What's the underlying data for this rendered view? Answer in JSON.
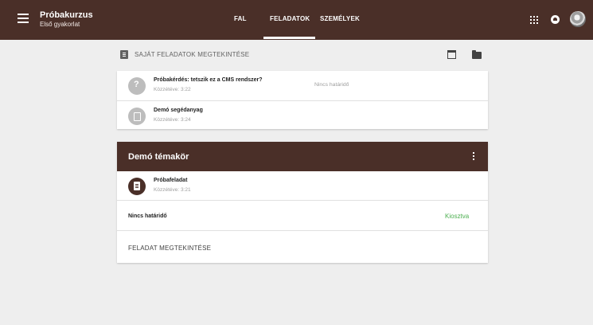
{
  "course": {
    "title": "Próbakurzus",
    "subtitle": "Első gyakorlat"
  },
  "nav": {
    "tabs": [
      {
        "label": "FAL"
      },
      {
        "label": "FELADATOK",
        "active": true
      },
      {
        "label": "SZEMÉLYEK"
      }
    ],
    "icons": [
      "menu-icon",
      "apps-icon",
      "notification-icon",
      "avatar"
    ]
  },
  "own_tasks": {
    "label": "SAJÁT FELADATOK MEGTEKINTÉSE",
    "icons": [
      "assignment-icon",
      "calendar-icon",
      "folder-icon"
    ]
  },
  "items": [
    {
      "title": "Próbakérdés: tetszik ez a CMS rendszer?",
      "published": "Közzétéve: 3:22",
      "due": "Nincs határidő",
      "icon": "question-icon"
    },
    {
      "title": "Demó segédanyag",
      "published": "Közzétéve: 3:24",
      "icon": "material-icon"
    }
  ],
  "topic": {
    "title": "Demó témakör",
    "task": {
      "title": "Próbafeladat",
      "published": "Közzétéve: 3:21"
    },
    "deadline": "Nincs határidő",
    "status": "Kiosztva",
    "view_link": "FELADAT MEGTEKINTÉSE"
  },
  "colors": {
    "brand": "#4a2f28",
    "status_green": "#4caf50",
    "background": "#eeeeee"
  }
}
